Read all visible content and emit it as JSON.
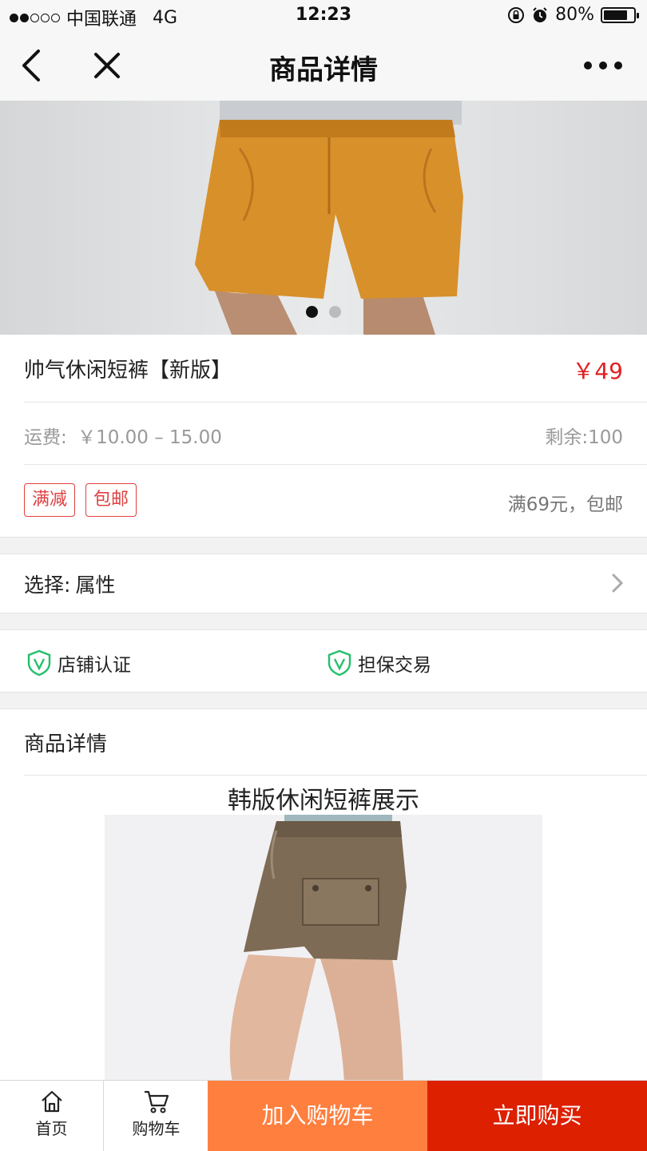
{
  "status_bar": {
    "carrier": "中国联通",
    "network": "4G",
    "time": "12:23",
    "battery": "80%",
    "battery_level": 0.8,
    "signal_bars": 2
  },
  "nav": {
    "title": "商品详情",
    "back_icon": "chevron-left-icon",
    "close_icon": "close-icon",
    "more_icon": "more-horizontal-icon"
  },
  "banner": {
    "dots": 2,
    "active_dot": 0
  },
  "product": {
    "title": "帅气休闲短裤【新版】",
    "price": "￥49",
    "shipping_label": "运费:",
    "shipping_range": "￥10.00 – 15.00",
    "stock": "剩余:100",
    "tags": [
      "满减",
      "包邮"
    ],
    "promo": "满69元，包邮"
  },
  "select": {
    "label": "选择:",
    "value": "属性"
  },
  "guarantees": [
    "店铺认证",
    "担保交易"
  ],
  "details": {
    "heading": "商品详情",
    "caption": "韩版休闲短裤展示"
  },
  "bottom_bar": {
    "home": "首页",
    "cart": "购物车",
    "add_to_cart": "加入购物车",
    "buy_now": "立即购买"
  },
  "colors": {
    "price_red": "#e02020",
    "cart_orange": "#ff7f3f",
    "buy_red": "#dd2000",
    "shield_green": "#22c06a"
  }
}
